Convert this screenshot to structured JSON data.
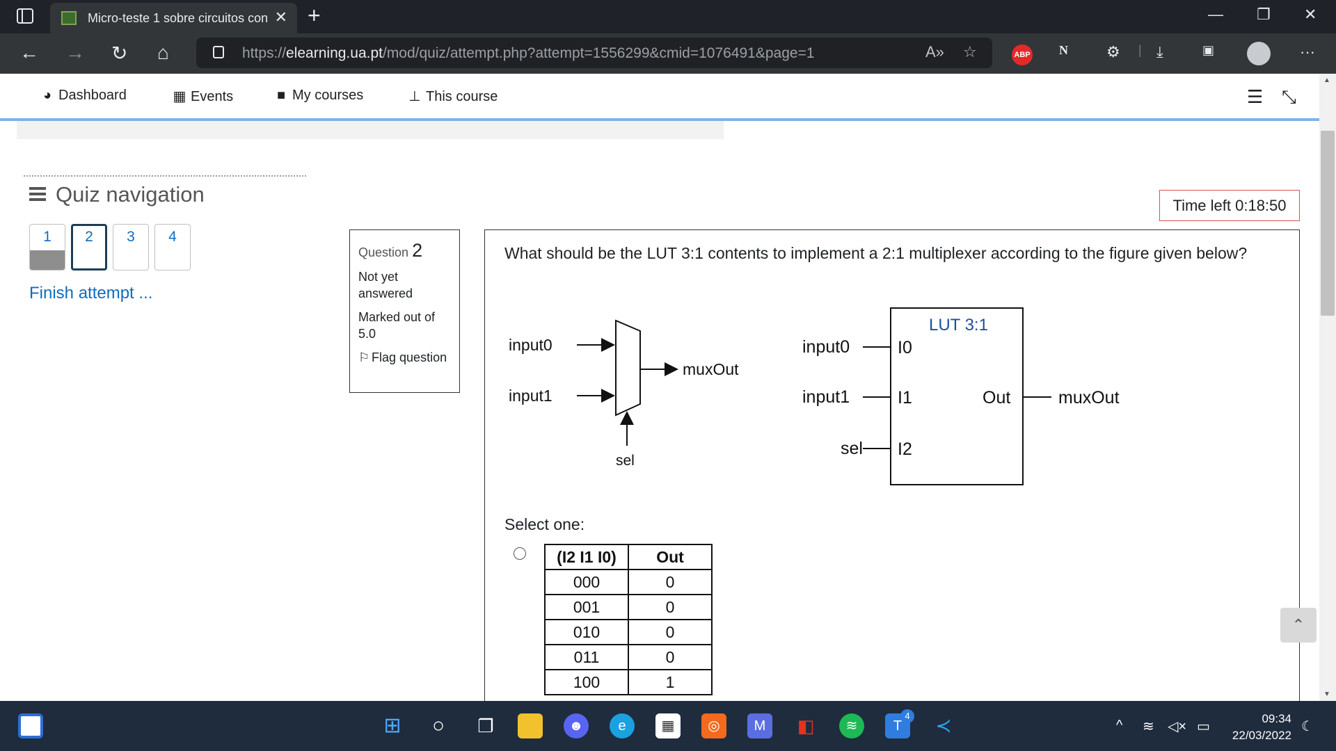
{
  "browser": {
    "tab_title": "Micro-teste 1 sobre circuitos con",
    "url_prefix": "https://",
    "url_domain": "elearning.ua.pt",
    "url_path": "/mod/quiz/attempt.php?attempt=1556299&cmid=1076491&page=1",
    "icons": [
      "back-icon",
      "forward-icon",
      "refresh-icon",
      "home-icon",
      "lock-icon",
      "read-aloud-icon",
      "favorites-icon",
      "abp-icon",
      "extensions-icon",
      "download-icon",
      "profile-icon",
      "more-icon"
    ],
    "abp_label": "ABP"
  },
  "moodle_nav": {
    "items": [
      {
        "label": "Dashboard",
        "icon": "dashboard-icon"
      },
      {
        "label": "Events",
        "icon": "calendar-icon"
      },
      {
        "label": "My courses",
        "icon": "briefcase-icon"
      },
      {
        "label": "This course",
        "icon": "sitemap-icon"
      }
    ]
  },
  "quiz_nav": {
    "title": "Quiz navigation",
    "questions": [
      {
        "number": "1",
        "state": "answered"
      },
      {
        "number": "2",
        "state": "current"
      },
      {
        "number": "3",
        "state": "unanswered"
      },
      {
        "number": "4",
        "state": "unanswered"
      }
    ],
    "finish_label": "Finish attempt ..."
  },
  "question_info": {
    "prefix": "Question",
    "number": "2",
    "status": "Not yet answered",
    "marks": "Marked out of 5.0",
    "flag_label": "Flag question"
  },
  "timer": "Time left 0:18:50",
  "question": {
    "text": "What should be the LUT 3:1 contents to implement a 2:1 multiplexer according to the figure given below?",
    "figure": {
      "mux_input0": "input0",
      "mux_input1": "input1",
      "mux_output": "muxOut",
      "mux_sel": "sel",
      "lut_title": "LUT 3:1",
      "lut_in_labels": [
        "input0",
        "input1",
        "sel"
      ],
      "lut_pins": [
        "I0",
        "I1",
        "I2"
      ],
      "lut_out_pin": "Out",
      "lut_output": "muxOut"
    },
    "select_label": "Select one:",
    "option_table": {
      "headers": [
        "(I2 I1 I0)",
        "Out"
      ],
      "rows": [
        [
          "000",
          "0"
        ],
        [
          "001",
          "0"
        ],
        [
          "010",
          "0"
        ],
        [
          "011",
          "0"
        ],
        [
          "100",
          "1"
        ]
      ]
    }
  },
  "taskbar": {
    "apps": [
      "start-icon",
      "search-icon",
      "task-view-icon",
      "file-explorer-icon",
      "discord-icon",
      "edge-icon",
      "store-icon",
      "app-icon",
      "mathpix-icon",
      "office-icon",
      "spotify-icon",
      "teams-icon",
      "vscode-icon"
    ],
    "badge": "4",
    "time": "09:34",
    "date": "22/03/2022"
  }
}
